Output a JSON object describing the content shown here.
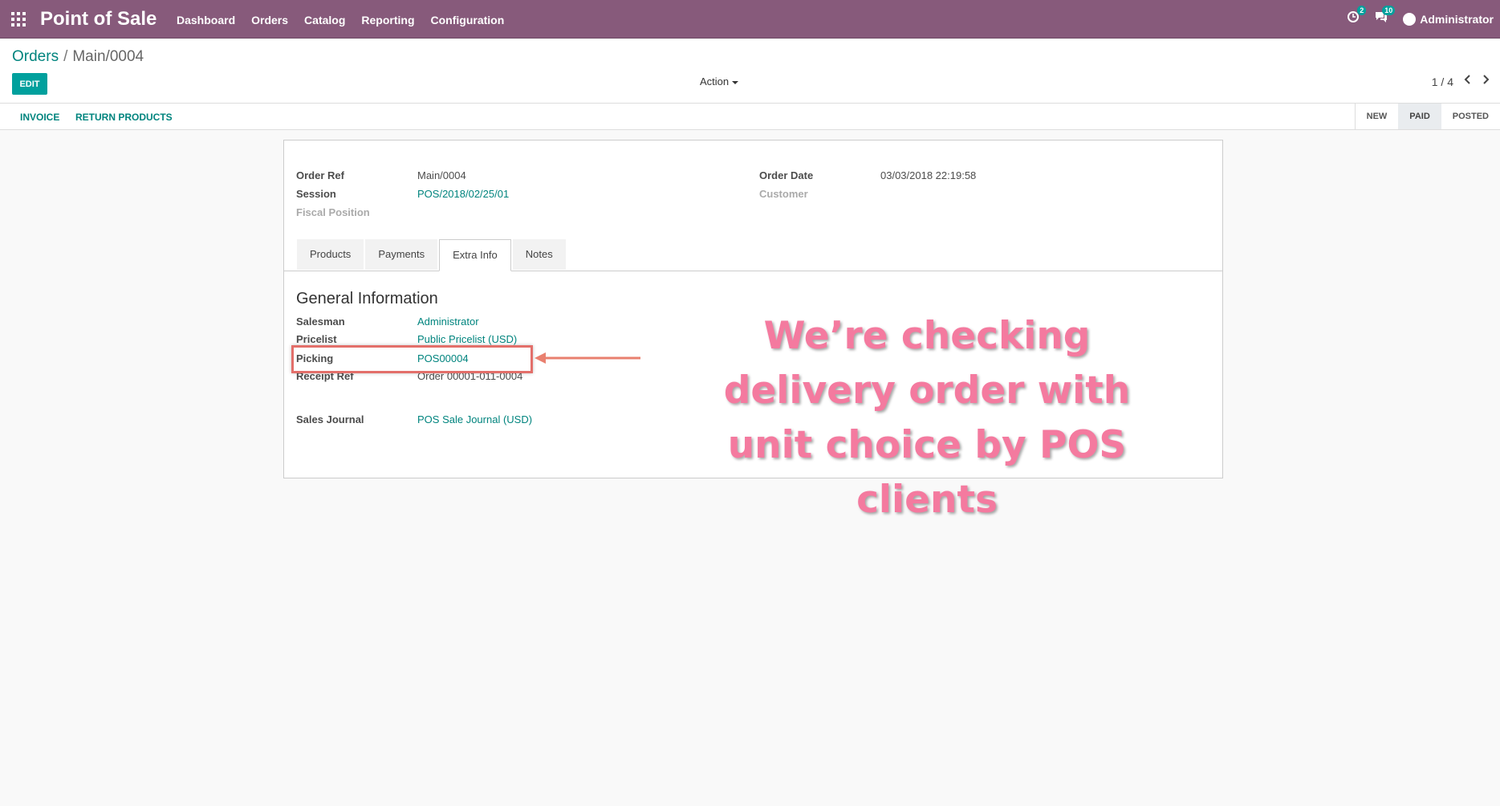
{
  "navbar": {
    "brand": "Point of Sale",
    "menu": [
      "Dashboard",
      "Orders",
      "Catalog",
      "Reporting",
      "Configuration"
    ],
    "activity_count": "2",
    "messages_count": "10",
    "user": "Administrator"
  },
  "breadcrumb": {
    "parent": "Orders",
    "separator": "/",
    "current": "Main/0004"
  },
  "toolbar": {
    "edit_label": "EDIT",
    "action_label": "Action",
    "pager": "1 / 4"
  },
  "statusbar": {
    "buttons": [
      "INVOICE",
      "RETURN PRODUCTS"
    ],
    "stages": [
      "NEW",
      "PAID",
      "POSTED"
    ],
    "active_stage": "PAID"
  },
  "form": {
    "order_ref_label": "Order Ref",
    "order_ref": "Main/0004",
    "session_label": "Session",
    "session": "POS/2018/02/25/01",
    "fiscal_position_label": "Fiscal Position",
    "order_date_label": "Order Date",
    "order_date": "03/03/2018 22:19:58",
    "customer_label": "Customer"
  },
  "tabs": [
    "Products",
    "Payments",
    "Extra Info",
    "Notes"
  ],
  "active_tab": "Extra Info",
  "extra_info": {
    "section_title": "General Information",
    "salesman_label": "Salesman",
    "salesman": "Administrator",
    "pricelist_label": "Pricelist",
    "pricelist": "Public Pricelist (USD)",
    "picking_label": "Picking",
    "picking": "POS00004",
    "receipt_ref_label": "Receipt Ref",
    "receipt_ref": "Order 00001-011-0004",
    "sales_journal_label": "Sales Journal",
    "sales_journal": "POS Sale Journal (USD)"
  },
  "annotation": {
    "text": "We’re checking delivery order with unit choice by POS clients",
    "color": "#f47a9f",
    "box_color": "#e36f6a"
  },
  "colors": {
    "navbar": "#875a7b",
    "accent": "#00a09d",
    "link": "#00847e"
  }
}
